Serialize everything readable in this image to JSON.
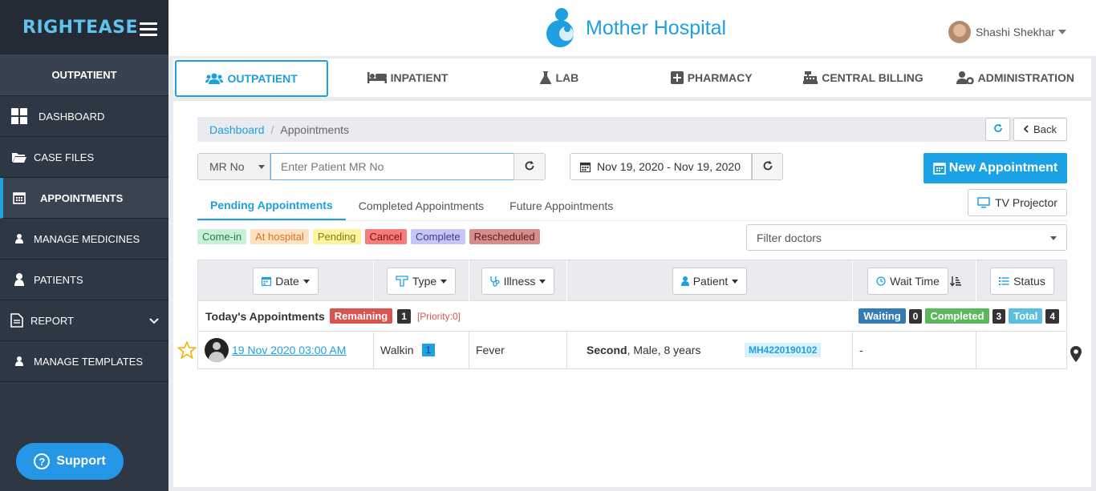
{
  "app": {
    "logo": "RIGHTEASE",
    "hospital_name": "Mother Hospital",
    "user_name": "Shashi Shekhar"
  },
  "sidebar": {
    "section_title": "OUTPATIENT",
    "items": [
      {
        "label": "DASHBOARD",
        "icon": "dashboard-icon"
      },
      {
        "label": "CASE FILES",
        "icon": "folder-icon"
      },
      {
        "label": "APPOINTMENTS",
        "icon": "calendar-icon",
        "active": true
      },
      {
        "label": "MANAGE MEDICINES",
        "icon": "user-icon"
      },
      {
        "label": "PATIENTS",
        "icon": "user-icon"
      },
      {
        "label": "REPORT",
        "icon": "document-icon"
      },
      {
        "label": "MANAGE TEMPLATES",
        "icon": "user-icon"
      }
    ],
    "support_label": "Support"
  },
  "modules": [
    {
      "label": "OUTPATIENT",
      "icon": "users-icon",
      "active": true
    },
    {
      "label": "INPATIENT",
      "icon": "bed-icon"
    },
    {
      "label": "LAB",
      "icon": "flask-icon"
    },
    {
      "label": "PHARMACY",
      "icon": "plus-square-icon"
    },
    {
      "label": "CENTRAL BILLING",
      "icon": "cash-register-icon"
    },
    {
      "label": "ADMINISTRATION",
      "icon": "user-cog-icon"
    }
  ],
  "breadcrumb": {
    "root": "Dashboard",
    "current": "Appointments"
  },
  "toolbar": {
    "back_label": "Back"
  },
  "search": {
    "mr_select": "MR No",
    "mr_placeholder": "Enter Patient MR No",
    "date_range": "Nov 19, 2020 - Nov 19, 2020"
  },
  "new_appointment_label": "New Appointment",
  "tv_projector_label": "TV Projector",
  "tabs": [
    {
      "label": "Pending Appointments",
      "active": true
    },
    {
      "label": "Completed Appointments"
    },
    {
      "label": "Future Appointments"
    }
  ],
  "legend": [
    {
      "label": "Come-in",
      "bg": "#c8f0d8",
      "color": "#2a7a4a"
    },
    {
      "label": "At hospital",
      "bg": "#fde2c2",
      "color": "#e07020"
    },
    {
      "label": "Pending",
      "bg": "#fbf5a0",
      "color": "#8a7a10"
    },
    {
      "label": "Cancel",
      "bg": "#f77b7b",
      "color": "#7a1010"
    },
    {
      "label": "Complete",
      "bg": "#c6c6f7",
      "color": "#3b3b9a"
    },
    {
      "label": "Rescheduled",
      "bg": "#d88c8c",
      "color": "#5a1a1a"
    }
  ],
  "filter_doctors_placeholder": "Filter doctors",
  "table": {
    "headers": {
      "date": "Date",
      "type": "Type",
      "illness": "Illness",
      "patient": "Patient",
      "wait_time": "Wait Time",
      "status": "Status"
    },
    "today": {
      "title": "Today's Appointments",
      "remaining_label": "Remaining",
      "remaining_count": "1",
      "priority": "[Priority:0]",
      "waiting_label": "Waiting",
      "waiting_count": "0",
      "completed_label": "Completed",
      "completed_count": "3",
      "total_label": "Total",
      "total_count": "4"
    },
    "rows": [
      {
        "date": "19 Nov 2020 03:00 AM",
        "type": "Walkin",
        "type_count": "1",
        "illness": "Fever",
        "patient_name": "Second",
        "patient_info": ", Male, 8 years",
        "mr_no": "MH4220190102",
        "wait_time": "-"
      }
    ]
  }
}
